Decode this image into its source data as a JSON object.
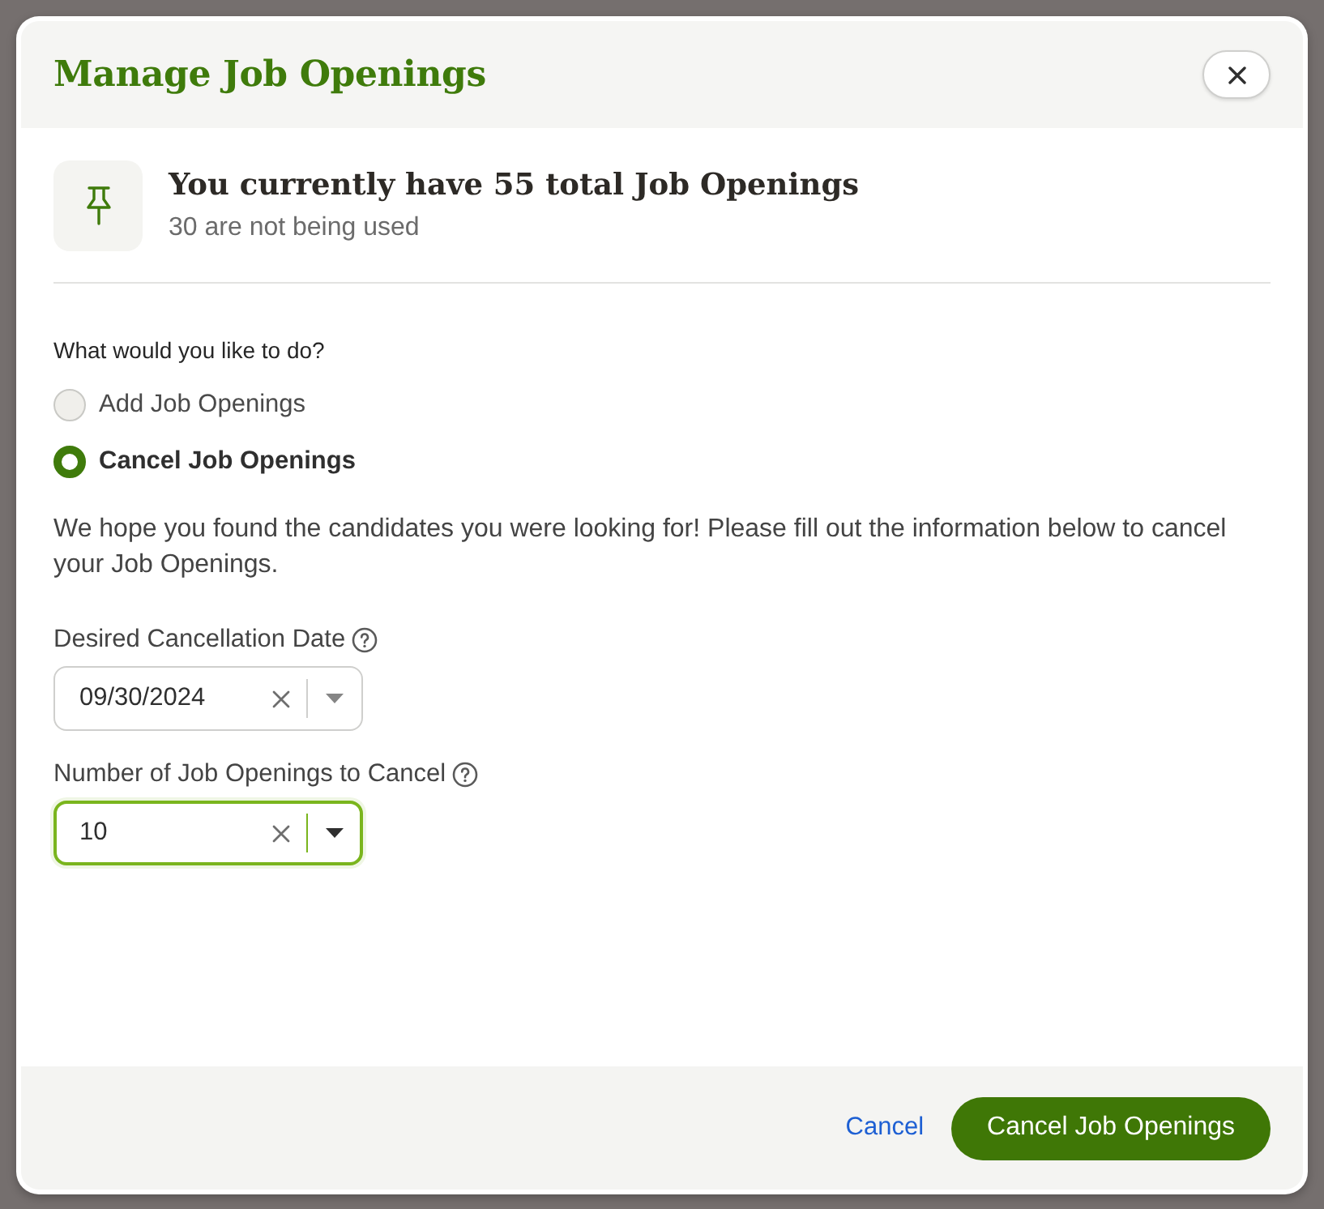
{
  "dialog": {
    "title": "Manage Job Openings"
  },
  "summary": {
    "heading": "You currently have 55 total Job Openings",
    "subtext": "30 are not being used"
  },
  "question": "What would you like to do?",
  "options": [
    {
      "label": "Add Job Openings",
      "selected": false
    },
    {
      "label": "Cancel Job Openings",
      "selected": true
    }
  ],
  "message": "We hope you found the candidates you were looking for! Please fill out the information below to cancel your Job Openings.",
  "fields": [
    {
      "label": "Desired Cancellation Date",
      "value": "09/30/2024",
      "focused": false
    },
    {
      "label": "Number of Job Openings to Cancel",
      "value": "10",
      "focused": true
    }
  ],
  "footer": {
    "buttons": [
      {
        "label": "Cancel",
        "kind": "link"
      },
      {
        "label": "Cancel Job Openings",
        "kind": "primary"
      }
    ]
  }
}
